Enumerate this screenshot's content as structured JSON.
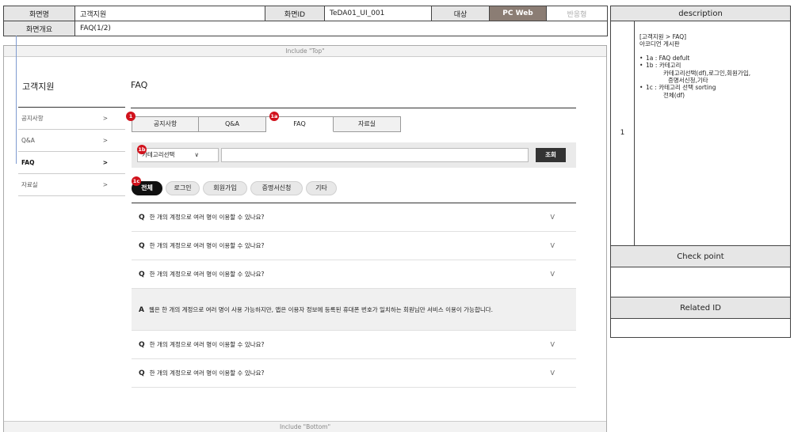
{
  "spec": {
    "screen_name_label": "화면명",
    "screen_name": "고객지원",
    "screen_id_label": "화면ID",
    "screen_id": "TeDA01_UI_001",
    "target_label": "대상",
    "target_pc": "PC Web",
    "target_responsive": "반응형",
    "overview_label": "화면개요",
    "overview": "FAQ(1/2)"
  },
  "description": {
    "header": "description",
    "number": "1",
    "title_line1": "[고객지원 > FAQ]",
    "title_line2": "아코디언 게시판",
    "items": [
      {
        "line1": "1a : FAQ defult",
        "line2": "",
        "line3": ""
      },
      {
        "line1": "1b : 카테고리",
        "line2": "카테고리선택(df),로그인,회원가입,",
        "line3": "증명서신청,기타"
      },
      {
        "line1": "1c : 카테고리 선택 sorting",
        "line2": "전체(df)",
        "line3": ""
      }
    ],
    "checkpoint_header": "Check point",
    "related_header": "Related ID"
  },
  "frame": {
    "include_top": "Include \"Top\"",
    "include_bottom": "Include \"Bottom\""
  },
  "sidebar": {
    "title": "고객지원",
    "items": [
      {
        "label": "공지사항",
        "arrow": ">"
      },
      {
        "label": "Q&A",
        "arrow": ">"
      },
      {
        "label": "FAQ",
        "arrow": ">"
      },
      {
        "label": "자료실",
        "arrow": ">"
      }
    ]
  },
  "main": {
    "title": "FAQ",
    "tabs": [
      "공지사항",
      "Q&A",
      "FAQ",
      "자료실"
    ],
    "badges": {
      "a": "1",
      "b": "1a",
      "c": "1b",
      "d": "1c"
    },
    "category_select": "카테고리선택",
    "select_chevron": "∨",
    "search_button": "조회",
    "chips": [
      "전체",
      "로그인",
      "회원가입",
      "증명서신청",
      "기타"
    ],
    "q_marker": "Q",
    "a_marker": "A",
    "chevron": "V",
    "questions": [
      "한 개의 계정으로 여러 명이 이용할 수 있나요?",
      "한 개의 계정으로 여러 명이 이용할 수 있나요?",
      "한 개의 계정으로 여러 명이 이용할 수 있나요?",
      "한 개의 계정으로 여러 명이 이용할 수 있나요?",
      "한 개의 계정으로 여러 명이 이용할 수 있나요?"
    ],
    "answer": "웹은 한 개의 계정으로 여러 명이 사용 가능하지만, 앱은 이용자 정보에 등록된 휴대폰 번호가 일치하는 회원님만 서비스 이용이 가능합니다."
  },
  "colors": {
    "pc_web_bg": "#8b7d74",
    "badge": "#d1121c",
    "active_chip": "#111111",
    "guide_line": "#7f9bd0"
  }
}
